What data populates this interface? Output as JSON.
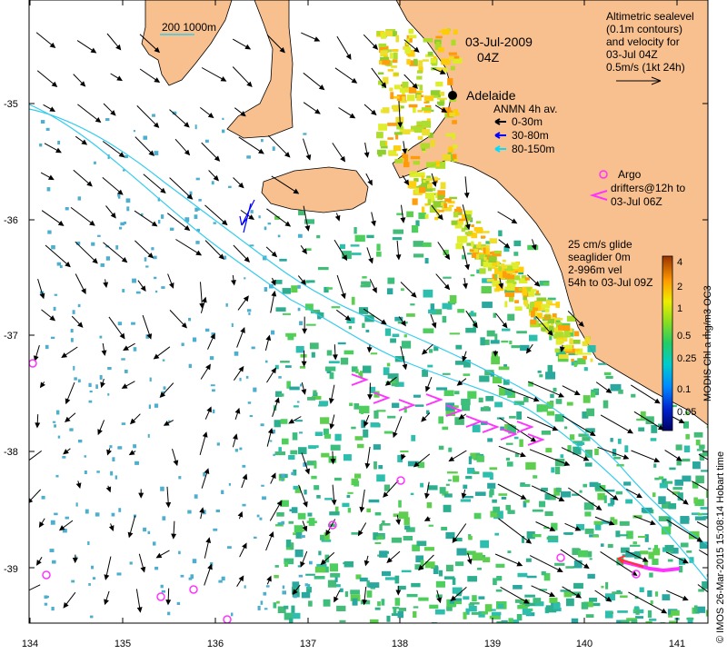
{
  "map": {
    "date_title": "03-Jul-2009",
    "time_title": "04Z",
    "lon_ticks": [
      "134",
      "135",
      "136",
      "137",
      "138",
      "139",
      "140",
      "141"
    ],
    "lat_ticks": [
      "-35",
      "-36",
      "-37",
      "-38",
      "-39"
    ],
    "scale_bar_label": "200  1000m",
    "city": {
      "name": "Adelaide"
    },
    "colors": {
      "land": "#f8c08f",
      "bathymetry_contour": "#33ccee",
      "argo": "#ff33ff",
      "drifter": "#ff33ff",
      "glider": "#ff3333"
    }
  },
  "sealevel_legend": {
    "lines": [
      "Altimetric sealevel",
      "(0.1m contours)",
      "and velocity for",
      "03-Jul 04Z",
      "0.5m/s (1kt 24h)"
    ]
  },
  "anmn_legend": {
    "title": "ANMN 4h av.",
    "items": [
      {
        "label": "0-30m",
        "color": "#000000"
      },
      {
        "label": "30-80m",
        "color": "#0000ff"
      },
      {
        "label": "80-150m",
        "color": "#00ddff"
      }
    ]
  },
  "argo_legend": {
    "argo_label": "Argo",
    "drifters_line1": "drifters@12h to",
    "drifters_line2": "03-Jul 06Z"
  },
  "glider_legend": {
    "lines": [
      "25 cm/s glide",
      "seaglider 0m",
      "2-996m vel",
      "54h to 03-Jul 09Z"
    ]
  },
  "colorbar": {
    "label": "MODIS Chl-a mg/m3 OC3",
    "tick_labels": [
      "4",
      "2",
      "1",
      "0.5",
      "0.25",
      "0.1",
      "0.05"
    ]
  },
  "credit": "© IMOS 26-Mar-2015 15:08:14 Hobart time"
}
